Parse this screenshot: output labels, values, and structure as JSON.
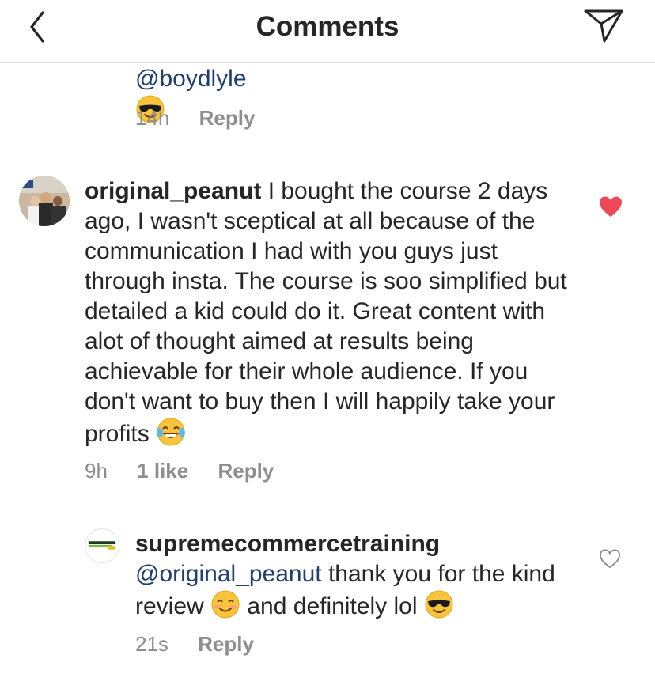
{
  "header": {
    "title": "Comments",
    "back_icon": "chevron-left-icon",
    "share_icon": "direct-send-icon"
  },
  "comments": [
    {
      "mention": "@boydlyle",
      "emoji": "sunglasses-emoji",
      "time": "14h",
      "reply": "Reply"
    },
    {
      "username": "original_peanut",
      "text": " I bought the course 2 days ago, I wasn't sceptical at all because of the communication I had with you guys just through insta. The course is soo simplified but detailed a kid could do it. Great content with alot of thought aimed at results being achievable for their whole audience. If you don't want to buy then I will happily take your profits ",
      "emoji": "tears-of-joy-emoji",
      "time": "9h",
      "likes": "1 like",
      "reply": "Reply",
      "liked": true
    },
    {
      "username": "supremecommercetraining",
      "mention": "@original_peanut",
      "text_a": " thank you for the kind review ",
      "text_b": " and definitely lol ",
      "emoji_a": "smiling-emoji",
      "emoji_b": "sunglasses-emoji",
      "time": "21s",
      "reply": "Reply",
      "liked": false
    }
  ],
  "colors": {
    "like_red": "#ed4956",
    "mention_blue": "#1f3f73",
    "meta_gray": "#8e8e8e",
    "divider": "#dbdbdb"
  }
}
